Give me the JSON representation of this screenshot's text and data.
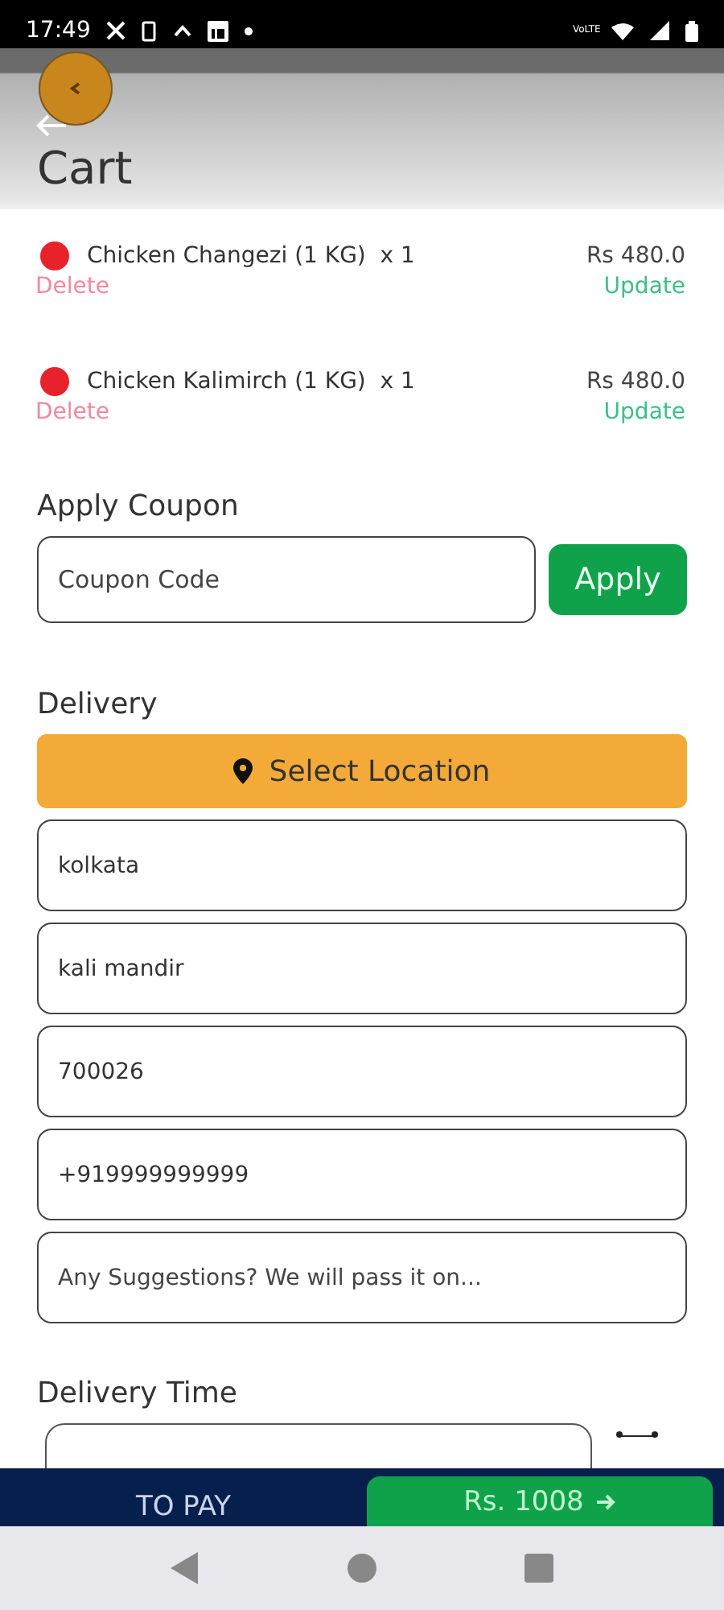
{
  "status_bar": {
    "time": "17:49",
    "network_label": "VoLTE"
  },
  "header": {
    "title": "Cart"
  },
  "cart_items": [
    {
      "name": "Chicken Changezi (1 KG)  x 1",
      "price": "Rs 480.0",
      "delete": "Delete",
      "update": "Update",
      "color": "#e8222b"
    },
    {
      "name": "Chicken Kalimirch (1 KG)  x 1",
      "price": "Rs 480.0",
      "delete": "Delete",
      "update": "Update",
      "color": "#e8222b"
    }
  ],
  "coupon": {
    "heading": "Apply Coupon",
    "placeholder": "Coupon Code",
    "button": "Apply"
  },
  "delivery": {
    "heading": "Delivery",
    "location_button": "Select Location",
    "fields": [
      {
        "value": "kolkata"
      },
      {
        "value": "kali mandir"
      },
      {
        "value": "700026"
      },
      {
        "value": "+919999999999"
      },
      {
        "placeholder": "Any Suggestions? We will pass it on..."
      }
    ]
  },
  "delivery_time": {
    "heading": "Delivery Time"
  },
  "footer": {
    "label": "TO PAY",
    "amount": "Rs. 1008"
  }
}
